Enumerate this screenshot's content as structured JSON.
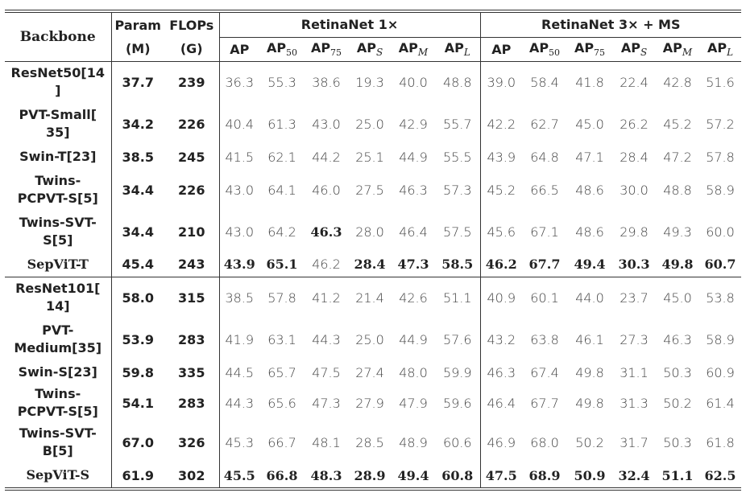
{
  "table": {
    "header": {
      "backbone": "Backbone",
      "param_line1": "Param",
      "param_line2": "(M)",
      "flops_line1": "FLOPs",
      "flops_line2": "(G)",
      "group1": "RetinaNet 1×",
      "group2": "RetinaNet 3× + MS",
      "metrics": [
        {
          "base": "AP",
          "sub": ""
        },
        {
          "base": "AP",
          "sub": "50"
        },
        {
          "base": "AP",
          "sub": "75"
        },
        {
          "base": "AP",
          "sub": "S"
        },
        {
          "base": "AP",
          "sub": "M"
        },
        {
          "base": "AP",
          "sub": "L"
        }
      ]
    },
    "groups": [
      {
        "rows": [
          {
            "name_lines": [
              "ResNet50[14",
              "]"
            ],
            "ref": "14",
            "param": "37.7",
            "flops": "239",
            "r1x": [
              "36.3",
              "55.3",
              "38.6",
              "19.3",
              "40.0",
              "48.8"
            ],
            "r1x_bold": [
              false,
              false,
              false,
              false,
              false,
              false
            ],
            "r3x": [
              "39.0",
              "58.4",
              "41.8",
              "22.4",
              "42.8",
              "51.6"
            ],
            "r3x_bold": [
              false,
              false,
              false,
              false,
              false,
              false
            ]
          },
          {
            "name_lines": [
              "PVT-Small[",
              "35]"
            ],
            "ref": "35",
            "param": "34.2",
            "flops": "226",
            "r1x": [
              "40.4",
              "61.3",
              "43.0",
              "25.0",
              "42.9",
              "55.7"
            ],
            "r1x_bold": [
              false,
              false,
              false,
              false,
              false,
              false
            ],
            "r3x": [
              "42.2",
              "62.7",
              "45.0",
              "26.2",
              "45.2",
              "57.2"
            ],
            "r3x_bold": [
              false,
              false,
              false,
              false,
              false,
              false
            ]
          },
          {
            "name_lines": [
              "Swin-T[23]"
            ],
            "ref": "23",
            "param": "38.5",
            "flops": "245",
            "r1x": [
              "41.5",
              "62.1",
              "44.2",
              "25.1",
              "44.9",
              "55.5"
            ],
            "r1x_bold": [
              false,
              false,
              false,
              false,
              false,
              false
            ],
            "r3x": [
              "43.9",
              "64.8",
              "47.1",
              "28.4",
              "47.2",
              "57.8"
            ],
            "r3x_bold": [
              false,
              false,
              false,
              false,
              false,
              false
            ]
          },
          {
            "name_lines": [
              "Twins-",
              "PCPVT-S[5]"
            ],
            "ref": "5",
            "param": "34.4",
            "flops": "226",
            "r1x": [
              "43.0",
              "64.1",
              "46.0",
              "27.5",
              "46.3",
              "57.3"
            ],
            "r1x_bold": [
              false,
              false,
              false,
              false,
              false,
              false
            ],
            "r3x": [
              "45.2",
              "66.5",
              "48.6",
              "30.0",
              "48.8",
              "58.9"
            ],
            "r3x_bold": [
              false,
              false,
              false,
              false,
              false,
              false
            ]
          },
          {
            "name_lines": [
              "Twins-SVT-",
              "S[5]"
            ],
            "ref": "5",
            "param": "34.4",
            "flops": "210",
            "r1x": [
              "43.0",
              "64.2",
              "46.3",
              "28.0",
              "46.4",
              "57.5"
            ],
            "r1x_bold": [
              false,
              false,
              true,
              false,
              false,
              false
            ],
            "r3x": [
              "45.6",
              "67.1",
              "48.6",
              "29.8",
              "49.3",
              "60.0"
            ],
            "r3x_bold": [
              false,
              false,
              false,
              false,
              false,
              false
            ]
          },
          {
            "name_lines": [
              "SepViT-T"
            ],
            "ref": "",
            "ours": true,
            "param": "45.4",
            "flops": "243",
            "r1x": [
              "43.9",
              "65.1",
              "46.2",
              "28.4",
              "47.3",
              "58.5"
            ],
            "r1x_bold": [
              true,
              true,
              false,
              true,
              true,
              true
            ],
            "r3x": [
              "46.2",
              "67.7",
              "49.4",
              "30.3",
              "49.8",
              "60.7"
            ],
            "r3x_bold": [
              true,
              true,
              true,
              true,
              true,
              true
            ]
          }
        ]
      },
      {
        "rows": [
          {
            "name_lines": [
              "ResNet101[",
              "14]"
            ],
            "ref": "14",
            "param": "58.0",
            "flops": "315",
            "r1x": [
              "38.5",
              "57.8",
              "41.2",
              "21.4",
              "42.6",
              "51.1"
            ],
            "r1x_bold": [
              false,
              false,
              false,
              false,
              false,
              false
            ],
            "r3x": [
              "40.9",
              "60.1",
              "44.0",
              "23.7",
              "45.0",
              "53.8"
            ],
            "r3x_bold": [
              false,
              false,
              false,
              false,
              false,
              false
            ]
          },
          {
            "name_lines": [
              "PVT-",
              "Medium[35]"
            ],
            "ref": "35",
            "param": "53.9",
            "flops": "283",
            "r1x": [
              "41.9",
              "63.1",
              "44.3",
              "25.0",
              "44.9",
              "57.6"
            ],
            "r1x_bold": [
              false,
              false,
              false,
              false,
              false,
              false
            ],
            "r3x": [
              "43.2",
              "63.8",
              "46.1",
              "27.3",
              "46.3",
              "58.9"
            ],
            "r3x_bold": [
              false,
              false,
              false,
              false,
              false,
              false
            ]
          },
          {
            "name_lines": [
              "Swin-S[23]"
            ],
            "ref": "23",
            "param": "59.8",
            "flops": "335",
            "r1x": [
              "44.5",
              "65.7",
              "47.5",
              "27.4",
              "48.0",
              "59.9"
            ],
            "r1x_bold": [
              false,
              false,
              false,
              false,
              false,
              false
            ],
            "r3x": [
              "46.3",
              "67.4",
              "49.8",
              "31.1",
              "50.3",
              "60.9"
            ],
            "r3x_bold": [
              false,
              false,
              false,
              false,
              false,
              false
            ]
          },
          {
            "name_lines": [
              "Twins-",
              "PCPVT-S[5]"
            ],
            "ref": "5",
            "param": "54.1",
            "flops": "283",
            "r1x": [
              "44.3",
              "65.6",
              "47.3",
              "27.9",
              "47.9",
              "59.6"
            ],
            "r1x_bold": [
              false,
              false,
              false,
              false,
              false,
              false
            ],
            "r3x": [
              "46.4",
              "67.7",
              "49.8",
              "31.3",
              "50.2",
              "61.4"
            ],
            "r3x_bold": [
              false,
              false,
              false,
              false,
              false,
              false
            ]
          },
          {
            "name_lines": [
              "Twins-SVT-",
              "B[5]"
            ],
            "ref": "5",
            "param": "67.0",
            "flops": "326",
            "r1x": [
              "45.3",
              "66.7",
              "48.1",
              "28.5",
              "48.9",
              "60.6"
            ],
            "r1x_bold": [
              false,
              false,
              false,
              false,
              false,
              false
            ],
            "r3x": [
              "46.9",
              "68.0",
              "50.2",
              "31.7",
              "50.3",
              "61.8"
            ],
            "r3x_bold": [
              false,
              false,
              false,
              false,
              false,
              false
            ]
          },
          {
            "name_lines": [
              "SepViT-S"
            ],
            "ref": "",
            "ours": true,
            "param": "61.9",
            "flops": "302",
            "r1x": [
              "45.5",
              "66.8",
              "48.3",
              "28.9",
              "49.4",
              "60.8"
            ],
            "r1x_bold": [
              true,
              true,
              true,
              true,
              true,
              true
            ],
            "r3x": [
              "47.5",
              "68.9",
              "50.9",
              "32.4",
              "51.1",
              "62.5"
            ],
            "r3x_bold": [
              true,
              true,
              true,
              true,
              true,
              true
            ]
          }
        ]
      }
    ]
  }
}
